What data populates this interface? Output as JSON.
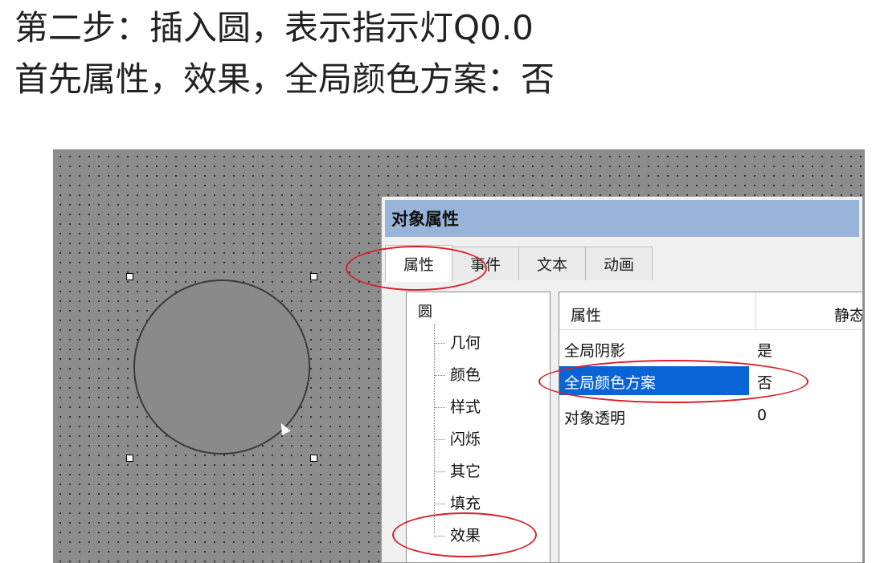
{
  "caption": {
    "line1": "第二步：插入圆，表示指示灯Q0.0",
    "line2": "首先属性，效果，全局颜色方案：否"
  },
  "dialog": {
    "title": "对象属性",
    "tabs": [
      {
        "label": "属性",
        "active": true
      },
      {
        "label": "事件",
        "active": false
      },
      {
        "label": "文本",
        "active": false
      },
      {
        "label": "动画",
        "active": false
      }
    ]
  },
  "tree": {
    "root": "圆",
    "items": [
      "几何",
      "颜色",
      "样式",
      "闪烁",
      "其它",
      "填充",
      "效果"
    ]
  },
  "properties": {
    "header_name": "属性",
    "header_value": "静态",
    "rows": [
      {
        "name": "全局阴影",
        "value": "是",
        "selected": false
      },
      {
        "name": "全局颜色方案",
        "value": "否",
        "selected": true
      },
      {
        "name": "对象透明",
        "value": "0",
        "selected": false
      }
    ]
  },
  "colors": {
    "selection": "#0a64d6",
    "titlebar": "#98b5d9",
    "highlight_oval": "#d8202a"
  }
}
